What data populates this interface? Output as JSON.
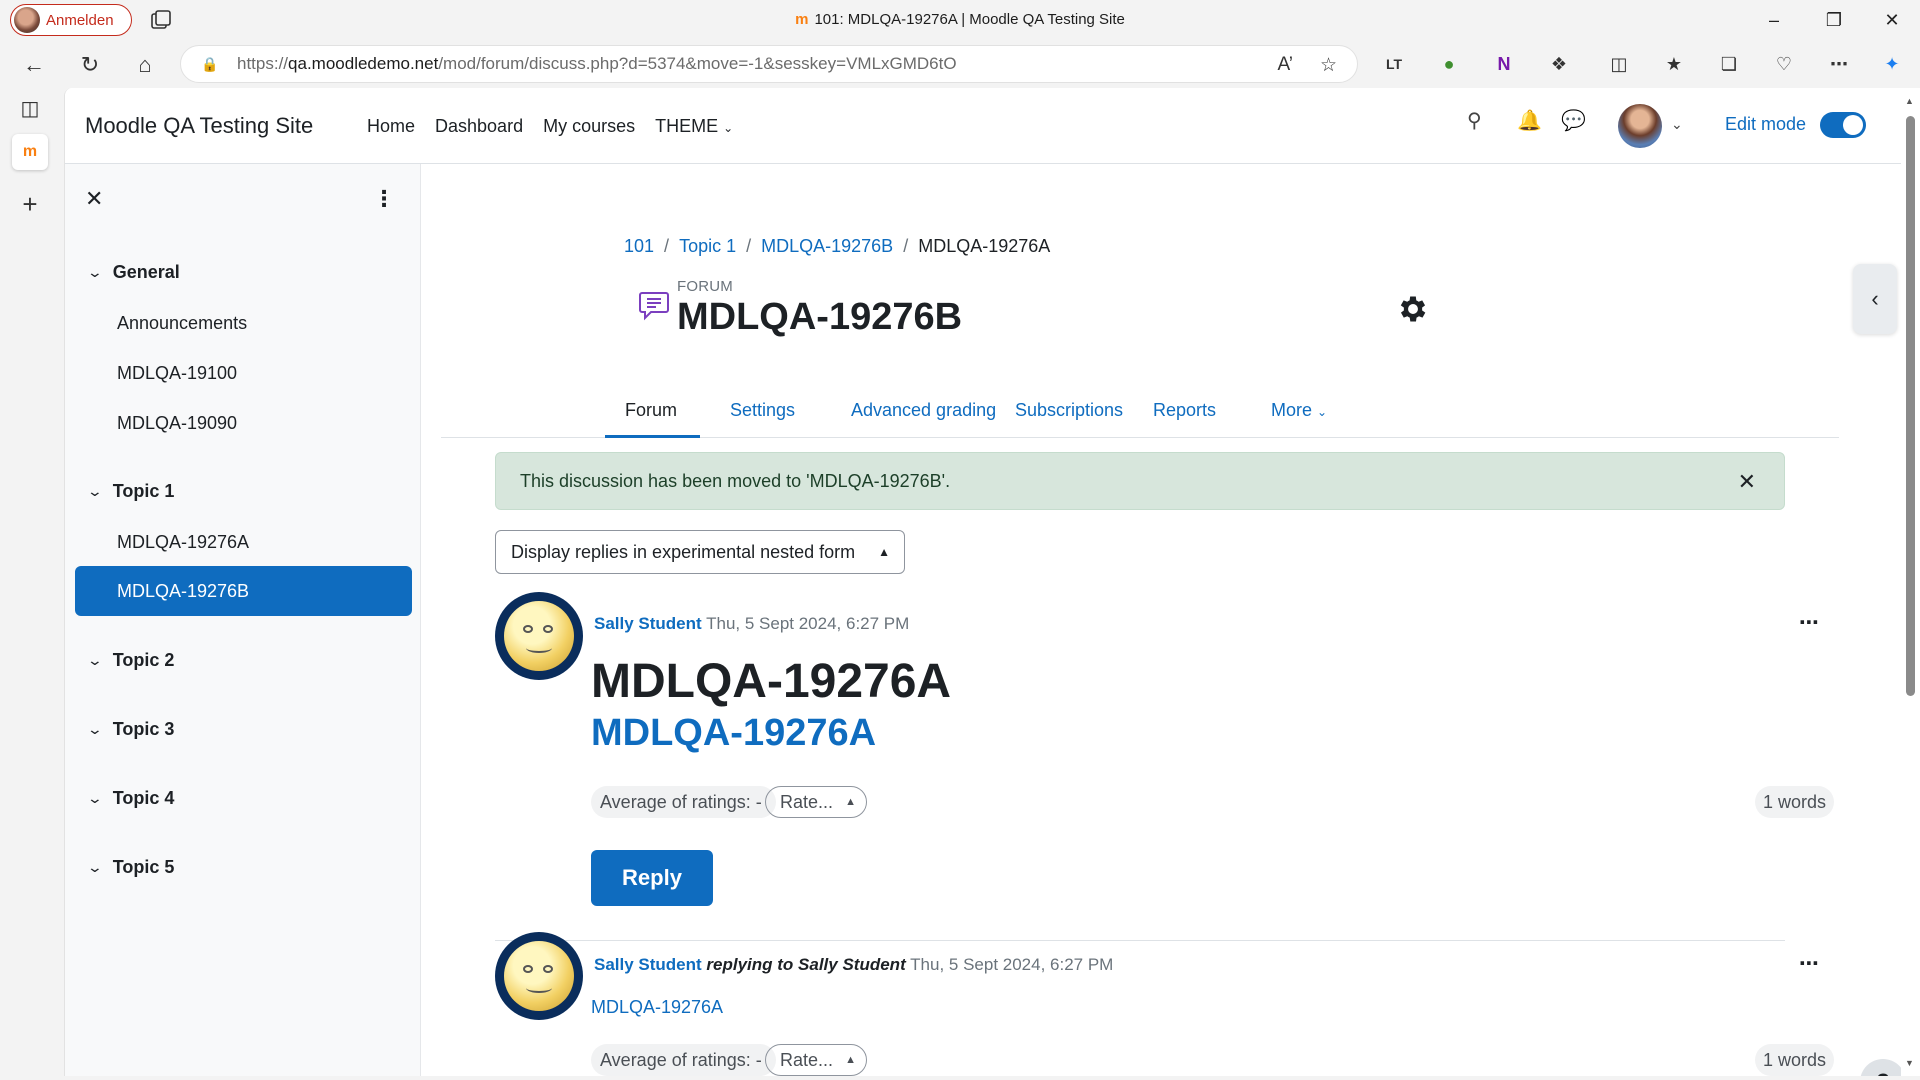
{
  "browser": {
    "profile_label": "Anmelden",
    "window_title": "101: MDLQA-19276A | Moodle QA Testing Site",
    "url_prefix": "https://",
    "url_host": "qa.moodledemo.net",
    "url_path": "/mod/forum/discuss.php?d=5374&move=-1&sesskey=VMLxGMD6tO"
  },
  "site": {
    "brand": "Moodle QA Testing Site",
    "nav": [
      "Home",
      "Dashboard",
      "My courses",
      "THEME"
    ],
    "edit_mode_label": "Edit mode",
    "edit_mode_on": true,
    "accent_color": "#0f6cbf"
  },
  "course_index": {
    "sections": [
      {
        "title": "General",
        "items": [
          "Announcements",
          "MDLQA-19100",
          "MDLQA-19090"
        ]
      },
      {
        "title": "Topic 1",
        "items": [
          "MDLQA-19276A",
          "MDLQA-19276B"
        ],
        "active_item": "MDLQA-19276B"
      },
      {
        "title": "Topic 2",
        "items": []
      },
      {
        "title": "Topic 3",
        "items": []
      },
      {
        "title": "Topic 4",
        "items": []
      },
      {
        "title": "Topic 5",
        "items": []
      }
    ]
  },
  "breadcrumb": [
    "101",
    "Topic 1",
    "MDLQA-19276B",
    "MDLQA-19276A"
  ],
  "header": {
    "activity_type": "FORUM",
    "title": "MDLQA-19276B"
  },
  "tabs": [
    "Forum",
    "Settings",
    "Advanced grading",
    "Subscriptions",
    "Reports",
    "More"
  ],
  "active_tab": "Forum",
  "alert": {
    "message": "This discussion has been moved to 'MDLQA-19276B'.",
    "color": "#d7e6dc"
  },
  "display_mode": "Display replies in experimental nested form",
  "posts": [
    {
      "author": "Sally Student",
      "replying_to": "",
      "date": "Thu, 5 Sept 2024, 6:27 PM",
      "subject": "MDLQA-19276A",
      "link": "MDLQA-19276A",
      "avg_ratings": "Average of ratings: -",
      "rate": "Rate...",
      "words": "1 words",
      "reply_label": "Reply"
    },
    {
      "author": "Sally Student",
      "replying_to": "replying to Sally Student",
      "date": "Thu, 5 Sept 2024, 6:27 PM",
      "link": "MDLQA-19276A",
      "avg_ratings": "Average of ratings: -",
      "rate": "Rate...",
      "words": "1 words"
    }
  ],
  "help_label": "?"
}
